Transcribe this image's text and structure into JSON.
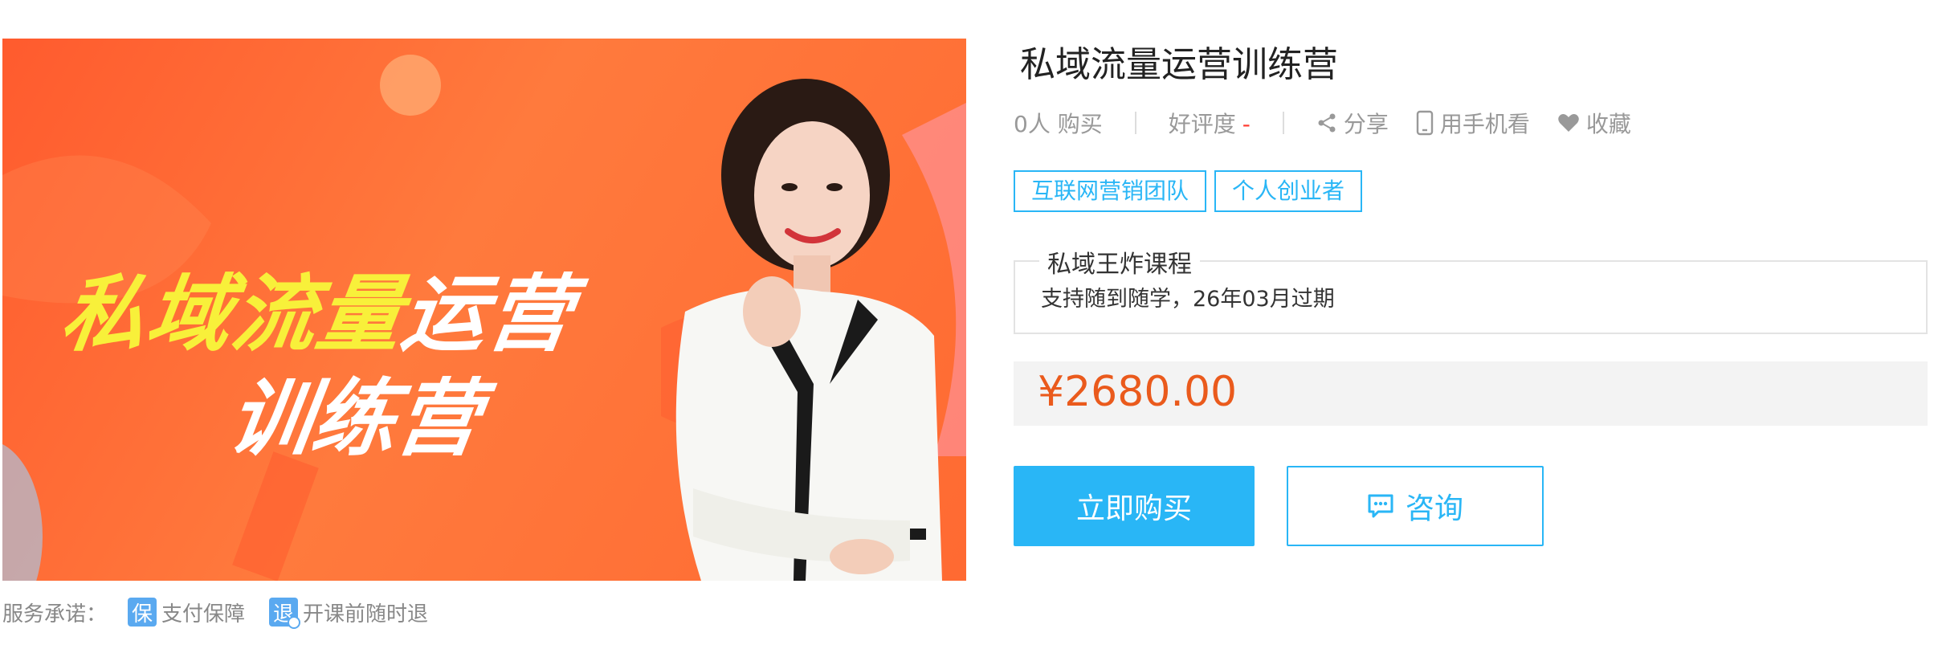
{
  "banner": {
    "title_yellow": "私域流量",
    "title_white": "运营",
    "title_line2": "训练营"
  },
  "course": {
    "title": "私域流量运营训练营"
  },
  "meta": {
    "buyers": "0人 购买",
    "rating_label": "好评度",
    "rating_value": "-",
    "share_label": "分享",
    "mobile_label": "用手机看",
    "favorite_label": "收藏"
  },
  "tags": [
    "互联网营销团队",
    "个人创业者"
  ],
  "source": {
    "legend": "私域王炸课程",
    "text": "支持随到随学，26年03月过期"
  },
  "price": "¥2680.00",
  "buttons": {
    "buy": "立即购买",
    "consult": "咨询"
  },
  "service": {
    "label": "服务承诺：",
    "items": [
      {
        "icon": "保",
        "label": "支付保障"
      },
      {
        "icon": "退",
        "label": "开课前随时退"
      }
    ]
  },
  "colors": {
    "accent": "#29b6f6",
    "price": "#ea5a1c",
    "banner_bg": "#ff6a32",
    "banner_highlight": "#f8f03a"
  }
}
